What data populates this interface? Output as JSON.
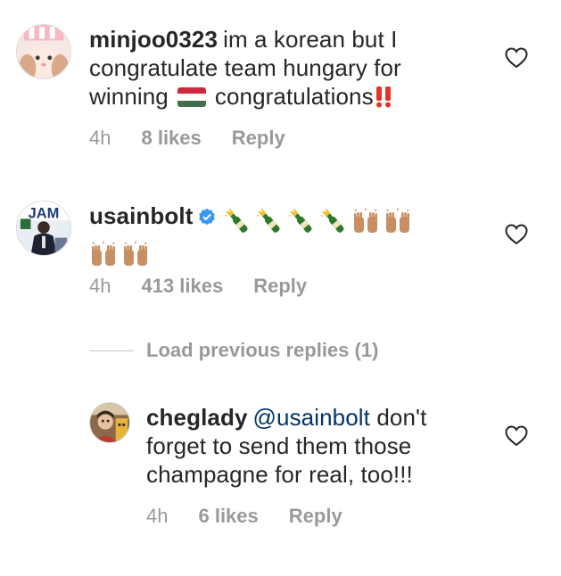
{
  "comments": [
    {
      "username": "minjoo0323",
      "text_line1": "im a korean but I",
      "text_line2": "congratulate  team hungary for",
      "text_line3a": "winning",
      "text_line3b": "congratulations",
      "time": "4h",
      "likes": "8 likes",
      "reply": "Reply"
    },
    {
      "username": "usainbolt",
      "time": "4h",
      "likes": "413 likes",
      "reply": "Reply"
    },
    {
      "username": "cheglady",
      "mention": "@usainbolt",
      "text_line1": "don't",
      "text_line2": "forget to send them those",
      "text_line3": "champagne for real, too!!!",
      "time": "4h",
      "likes": "6 likes",
      "reply": "Reply"
    }
  ],
  "load_previous": "Load previous replies (1)",
  "colors": {
    "text": "#262626",
    "meta": "#999999",
    "mention": "#003569",
    "verified": "#3897f0"
  },
  "icons": [
    "heart-outline-icon",
    "verified-badge-icon",
    "champagne-emoji",
    "raised-hands-emoji",
    "hungary-flag-emoji",
    "double-exclamation-emoji"
  ]
}
